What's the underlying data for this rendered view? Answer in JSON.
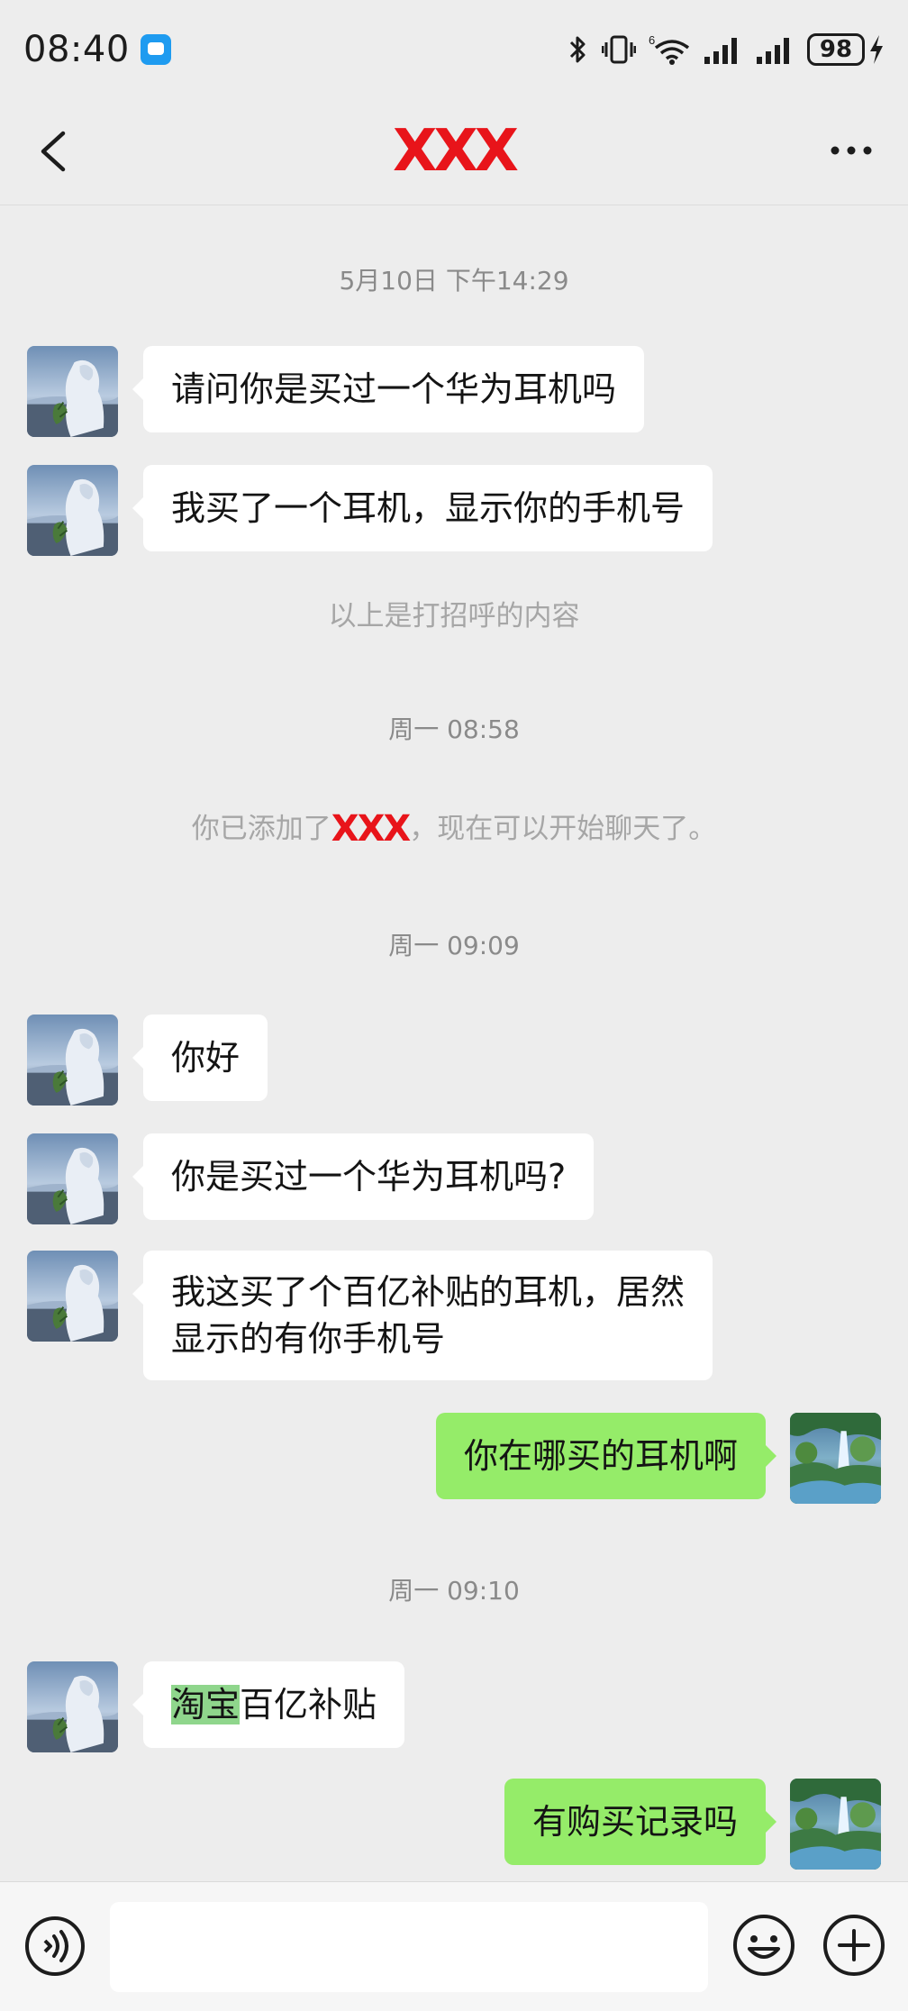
{
  "status_bar": {
    "time": "08:40",
    "battery": "98",
    "icons": [
      "bluetooth-icon",
      "vibrate-icon",
      "wifi-icon",
      "signal-icon",
      "signal-icon",
      "battery-icon",
      "charging-icon"
    ]
  },
  "nav": {
    "title": "XXX",
    "back_icon": "chevron-left-icon",
    "more_icon": "more-icon"
  },
  "chat": {
    "timestamps": [
      "5月10日 下午14:29",
      "周一 08:58",
      "周一 09:09",
      "周一 09:10"
    ],
    "system": {
      "greeting_note": "以上是打招呼的内容",
      "added_prefix": "你已添加了",
      "added_name": "XXX",
      "added_suffix": "，现在可以开始聊天了。"
    },
    "messages": [
      {
        "side": "left",
        "text": "请问你是买过一个华为耳机吗"
      },
      {
        "side": "left",
        "text": "我买了一个耳机，显示你的手机号"
      },
      {
        "side": "left",
        "text": "你好"
      },
      {
        "side": "left",
        "text": "你是买过一个华为耳机吗?"
      },
      {
        "side": "left",
        "line1": "我这买了个百亿补贴的耳机，居然",
        "line2": "显示的有你手机号"
      },
      {
        "side": "right",
        "text": "你在哪买的耳机啊"
      },
      {
        "side": "left",
        "highlight": "淘宝",
        "rest": "百亿补贴"
      },
      {
        "side": "right",
        "text": "有购买记录吗"
      }
    ]
  },
  "input_bar": {
    "value": "",
    "icons": [
      "voice-icon",
      "emoji-icon",
      "plus-icon"
    ]
  },
  "colors": {
    "background": "#ededed",
    "bubble_self": "#95ec69",
    "bubble_other": "#ffffff",
    "title_red": "#e8141a",
    "highlight": "#8fd68c"
  }
}
